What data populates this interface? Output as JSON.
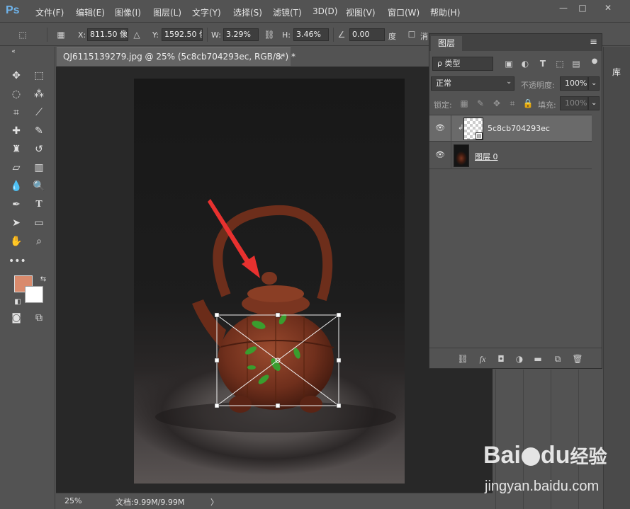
{
  "app": {
    "logo": "Ps"
  },
  "menu": [
    "文件(F)",
    "编辑(E)",
    "图像(I)",
    "图层(L)",
    "文字(Y)",
    "选择(S)",
    "滤镜(T)",
    "3D(D)",
    "视图(V)",
    "窗口(W)",
    "帮助(H)"
  ],
  "window_controls": {
    "minimize": "—",
    "maximize": "□",
    "close": "✕"
  },
  "options": {
    "x_label": "X:",
    "x_value": "811.50 像",
    "y_label": "Y:",
    "y_value": "1592.50 像",
    "w_label": "W:",
    "w_value": "3.29%",
    "h_label": "H:",
    "h_value": "3.46%",
    "angle_value": "0.00",
    "angle_unit": "度",
    "extra": "消"
  },
  "document": {
    "tab_title": "QJ6115139279.jpg @ 25% (5c8cb704293ec, RGB/8*) *",
    "tab_close": "×",
    "zoom": "25%",
    "doc_size": "文档:9.99M/9.99M",
    "status_arrow": "〉"
  },
  "colors": {
    "foreground": "#d98a6c",
    "background": "#ffffff",
    "accent": "#6fb3ea",
    "arrow": "#e8312f"
  },
  "layers_panel": {
    "tab": "图层",
    "filter_label": "ρ 类型",
    "blend_mode": "正常",
    "opacity_label": "不透明度:",
    "opacity_value": "100%",
    "lock_label": "锁定:",
    "fill_label": "填充:",
    "fill_value": "100%",
    "layers": [
      {
        "name": "5c8cb704293ec",
        "selected": true
      },
      {
        "name": "图层 0",
        "selected": false
      }
    ]
  },
  "right_dock": {
    "library_tab": "库"
  },
  "watermark": {
    "brand": "Bai",
    "paw": "du",
    "cn": "经验",
    "url": "jingyan.baidu.com"
  }
}
